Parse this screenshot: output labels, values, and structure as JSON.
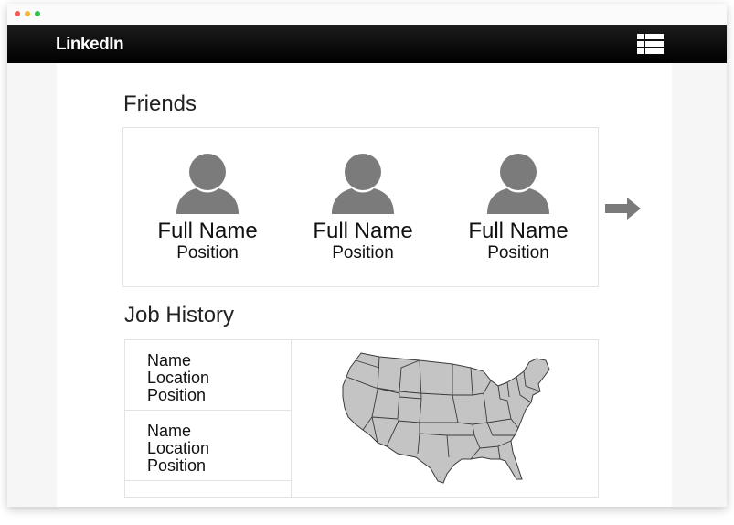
{
  "app": {
    "brand": "LinkedIn"
  },
  "icons": {
    "menu": "list-menu-icon",
    "next": "right-arrow-icon",
    "avatar": "person-avatar-icon",
    "map": "usa-map-icon"
  },
  "colors": {
    "navbar": "#000000",
    "brand_text": "#ffffff",
    "avatar": "#7b7b7b",
    "map_fill": "#c4c4c4"
  },
  "friends": {
    "title": "Friends",
    "people": [
      {
        "name": "Full Name",
        "position": "Position"
      },
      {
        "name": "Full Name",
        "position": "Position"
      },
      {
        "name": "Full Name",
        "position": "Position"
      }
    ]
  },
  "job_history": {
    "title": "Job History",
    "entries": [
      {
        "name": "Name",
        "location": "Location",
        "position": "Position"
      },
      {
        "name": "Name",
        "location": "Location",
        "position": "Position"
      }
    ]
  }
}
